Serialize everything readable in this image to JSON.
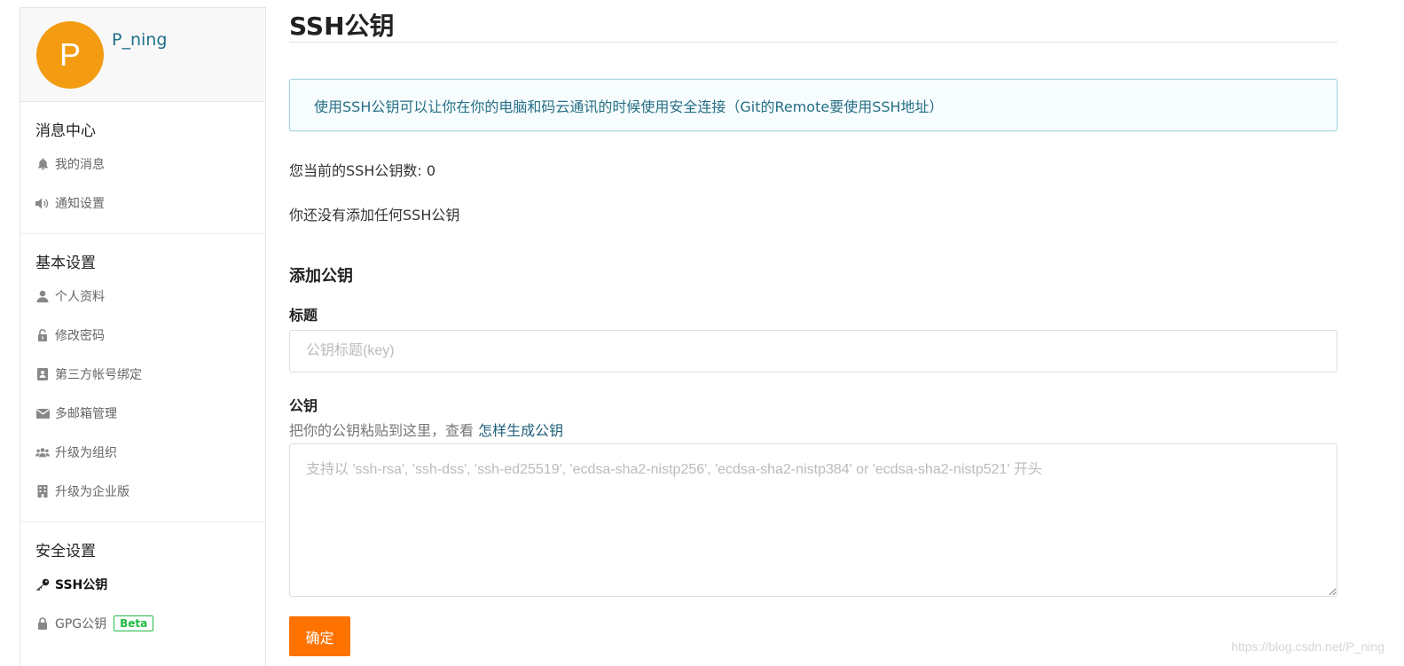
{
  "profile": {
    "avatar_letter": "P",
    "avatar_color": "#f39c12",
    "username": "P_ning"
  },
  "sidebar": {
    "groups": [
      {
        "title": "消息中心",
        "items": [
          {
            "label": "我的消息",
            "icon": "bell-icon"
          },
          {
            "label": "通知设置",
            "icon": "speaker-icon"
          }
        ]
      },
      {
        "title": "基本设置",
        "items": [
          {
            "label": "个人资料",
            "icon": "user-icon"
          },
          {
            "label": "修改密码",
            "icon": "unlock-icon"
          },
          {
            "label": "第三方帐号绑定",
            "icon": "contact-card-icon"
          },
          {
            "label": "多邮箱管理",
            "icon": "envelope-icon"
          },
          {
            "label": "升级为组织",
            "icon": "users-icon"
          },
          {
            "label": "升级为企业版",
            "icon": "building-icon"
          }
        ]
      },
      {
        "title": "安全设置",
        "items": [
          {
            "label": "SSH公钥",
            "icon": "key-icon",
            "active": true
          },
          {
            "label": "GPG公钥",
            "icon": "lock-icon",
            "badge": "Beta"
          }
        ]
      }
    ]
  },
  "main": {
    "title": "SSH公钥",
    "info_message": "使用SSH公钥可以让你在你的电脑和码云通讯的时候使用安全连接（Git的Remote要使用SSH地址）",
    "count_text": "您当前的SSH公钥数: 0",
    "empty_text": "你还没有添加任何SSH公钥",
    "add_section_title": "添加公钥",
    "title_field": {
      "label": "标题",
      "placeholder": "公钥标题(key)",
      "value": ""
    },
    "key_field": {
      "label": "公钥",
      "hint_prefix": "把你的公钥粘贴到这里，查看 ",
      "hint_link": "怎样生成公钥",
      "placeholder": "支持以 'ssh-rsa', 'ssh-dss', 'ssh-ed25519', 'ecdsa-sha2-nistp256', 'ecdsa-sha2-nistp384' or 'ecdsa-sha2-nistp521' 开头",
      "value": ""
    },
    "submit_label": "确定",
    "accent_color": "#fe7300"
  },
  "watermark": "https://blog.csdn.net/P_ning"
}
